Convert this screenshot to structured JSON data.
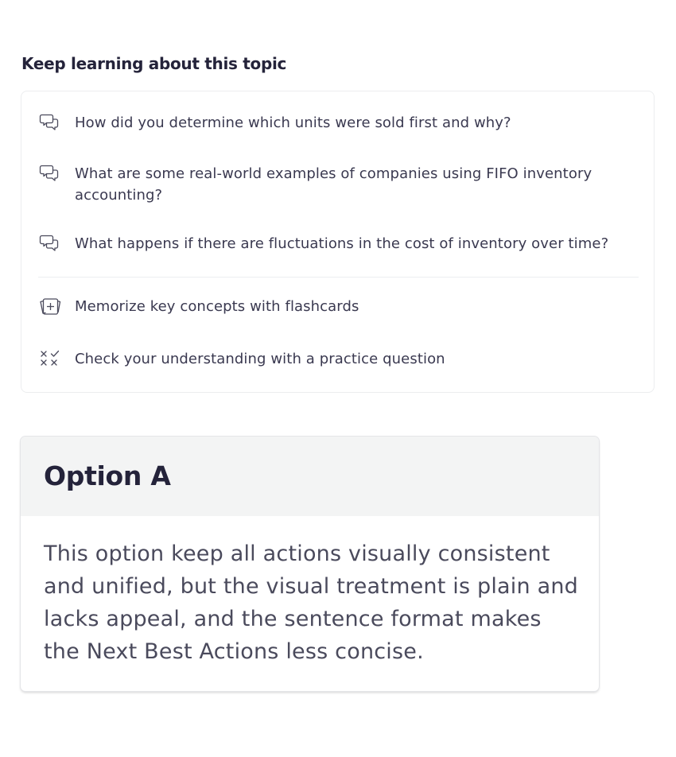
{
  "section": {
    "title": "Keep learning about this topic"
  },
  "suggestions": [
    {
      "icon": "chat-bubbles-icon",
      "label": "How did you determine which units were sold first and why?"
    },
    {
      "icon": "chat-bubbles-icon",
      "label": "What are some real-world examples of companies using FIFO inventory accounting?"
    },
    {
      "icon": "chat-bubbles-icon",
      "label": "What happens if there are fluctuations in the cost of inventory over time?"
    }
  ],
  "actions": [
    {
      "icon": "flashcards-icon",
      "label": "Memorize key concepts with flashcards"
    },
    {
      "icon": "practice-question-icon",
      "label": "Check your understanding with a practice question"
    }
  ],
  "option": {
    "title": "Option A",
    "body": "This option keep all actions visually consistent and unified, but the visual treatment is plain and lacks appeal, and the sentence format makes the Next Best Actions less concise."
  },
  "colors": {
    "text_dark": "#24233a",
    "text_body": "#3a3950",
    "card_border": "#ecedef",
    "option_header_bg": "#f3f4f4"
  }
}
